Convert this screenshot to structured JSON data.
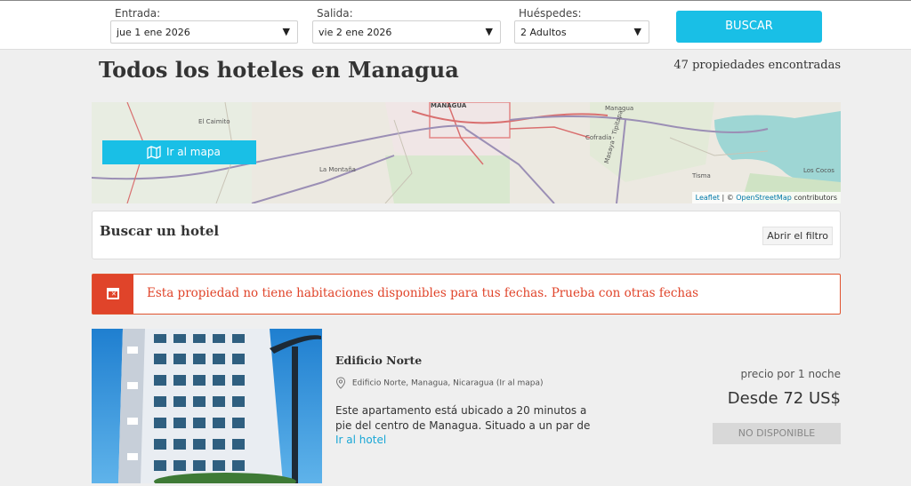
{
  "search": {
    "entrada": {
      "label": "Entrada:",
      "value": "jue 1 ene 2026"
    },
    "salida": {
      "label": "Salida:",
      "value": "vie 2 ene 2026"
    },
    "huespedes": {
      "label": "Huéspedes:",
      "value": "2 Adultos"
    },
    "button": "BUSCAR",
    "dropdown_icon": "triangle-down"
  },
  "page": {
    "title": "Todos los hoteles en Managua",
    "count": "47 propiedades encontradas"
  },
  "map": {
    "button": "Ir al mapa",
    "button_icon": "map-icon",
    "labels": {
      "managua": "MANAGUA",
      "managua_small": "Managua",
      "el_caimito": "El Caimito",
      "la_montana": "La Montaña",
      "cofradia": "Cofradía",
      "tisma": "Tisma",
      "los_cocos": "Los Cocos",
      "road": "Masaya - Tipitapa"
    },
    "attribution": {
      "leaflet": "Leaflet",
      "sep": " | © ",
      "osm": "OpenStreetMap",
      "tail": " contributors"
    }
  },
  "filter": {
    "title": "Buscar un hotel",
    "button": "Abrir el filtro"
  },
  "alert": {
    "icon": "calendar-x-icon",
    "text": "Esta propiedad no tiene habitaciones disponibles para tus fechas. Prueba con otras fechas"
  },
  "listing": {
    "name": "Edificio Norte",
    "location": "Edificio Norte, Managua, Nicaragua",
    "map_link": "(Ir al mapa)",
    "description": "Este apartamento está ubicado a 20 minutos a pie del centro de Managua. Situado a un par de",
    "link": "Ir al hotel",
    "price_label": "precio por 1 noche",
    "price": "Desde 72 US$",
    "status": "NO DISPONIBLE"
  },
  "colors": {
    "accent": "#19bfe6",
    "alert": "#e0442a",
    "disabled": "#d8d8d8"
  }
}
